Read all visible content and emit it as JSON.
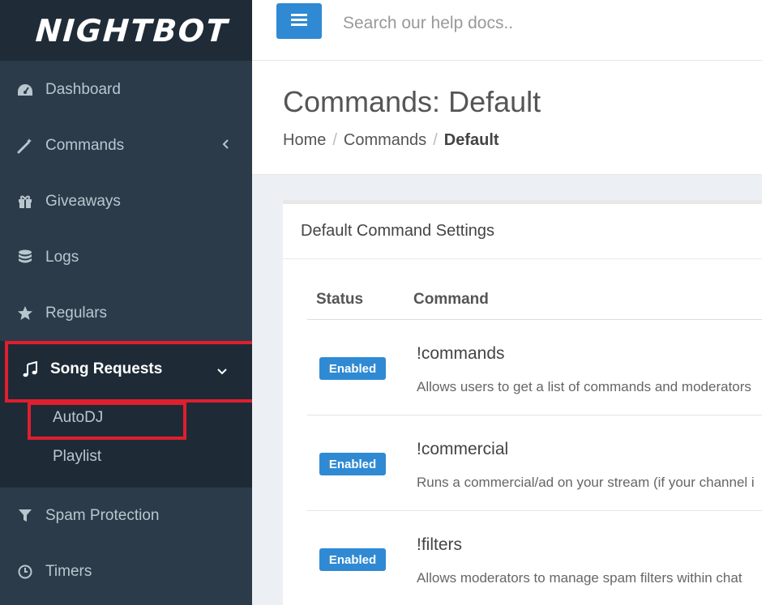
{
  "logo": {
    "text": "NIGHTBOT"
  },
  "sidebar": {
    "items": [
      {
        "label": "Dashboard",
        "icon": "dashboard-icon"
      },
      {
        "label": "Commands",
        "icon": "magic-wand-icon"
      },
      {
        "label": "Giveaways",
        "icon": "gift-icon"
      },
      {
        "label": "Logs",
        "icon": "database-icon"
      },
      {
        "label": "Regulars",
        "icon": "star-icon"
      },
      {
        "label": "Song Requests",
        "icon": "music-icon"
      },
      {
        "label": "Spam Protection",
        "icon": "filter-icon"
      },
      {
        "label": "Timers",
        "icon": "clock-icon"
      }
    ],
    "submenu": [
      {
        "label": "AutoDJ"
      },
      {
        "label": "Playlist"
      }
    ]
  },
  "topbar": {
    "search_placeholder": "Search our help docs.."
  },
  "page": {
    "title": "Commands: Default",
    "breadcrumb": [
      "Home",
      "Commands",
      "Default"
    ]
  },
  "panel": {
    "title": "Default Command Settings",
    "columns": [
      "Status",
      "Command"
    ],
    "rows": [
      {
        "status": "Enabled",
        "command": "!commands",
        "description": "Allows users to get a list of commands and moderators"
      },
      {
        "status": "Enabled",
        "command": "!commercial",
        "description": "Runs a commercial/ad on your stream (if your channel i"
      },
      {
        "status": "Enabled",
        "command": "!filters",
        "description": "Allows moderators to manage spam filters within chat"
      }
    ]
  },
  "colors": {
    "sidebar": "#2c3b4a",
    "accent": "#2f8ad3",
    "highlight": "#e01e2e"
  }
}
